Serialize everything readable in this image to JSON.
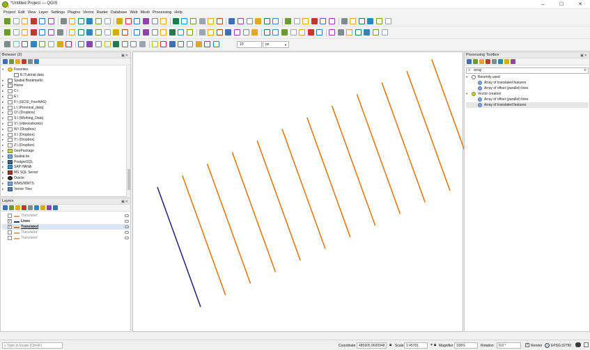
{
  "window": {
    "title": "*Untitled Project — QGIS",
    "minimize": "–",
    "maximize": "☐",
    "close": "✕"
  },
  "menubar": [
    "Project",
    "Edit",
    "View",
    "Layer",
    "Settings",
    "Plugins",
    "Vector",
    "Raster",
    "Database",
    "Web",
    "Mesh",
    "Processing",
    "Help"
  ],
  "digitizing": {
    "distance_value": "10",
    "unit": "px"
  },
  "browser": {
    "title": "Browser (2)",
    "items": [
      {
        "label": "Favorites",
        "type": "star",
        "expanded": true,
        "indent": 0
      },
      {
        "label": "E:\\Tutorial data",
        "type": "folder",
        "indent": 1
      },
      {
        "label": "Spatial Bookmarks",
        "type": "bookmark",
        "indent": 0
      },
      {
        "label": "Home",
        "type": "home",
        "indent": 0
      },
      {
        "label": "C:\\",
        "type": "drive",
        "indent": 0
      },
      {
        "label": "E:\\",
        "type": "drive",
        "indent": 0
      },
      {
        "label": "F:\\ (iSCSI_FreeNAS)",
        "type": "drive",
        "indent": 0
      },
      {
        "label": "L:\\ (Personal_data)",
        "type": "drive",
        "indent": 0
      },
      {
        "label": "O:\\ (Dropbox)",
        "type": "drive",
        "indent": 0
      },
      {
        "label": "S:\\ (Working_Data)",
        "type": "drive",
        "indent": 0
      },
      {
        "label": "V:\\ (videoosbooks)",
        "type": "drive",
        "indent": 0
      },
      {
        "label": "W:\\ (Dropbox)",
        "type": "drive",
        "indent": 0
      },
      {
        "label": "X:\\ (Dropbox)",
        "type": "drive",
        "indent": 0
      },
      {
        "label": "Y:\\ (Dropbox)",
        "type": "drive",
        "indent": 0
      },
      {
        "label": "Z:\\ (Dropbox)",
        "type": "drive",
        "indent": 0
      },
      {
        "label": "GeoPackage",
        "type": "gpkg",
        "indent": 0
      },
      {
        "label": "SpatiaLite",
        "type": "spatialite",
        "indent": 0
      },
      {
        "label": "PostgreSQL",
        "type": "postgres",
        "indent": 0
      },
      {
        "label": "SAP HANA",
        "type": "hana",
        "indent": 0
      },
      {
        "label": "MS SQL Server",
        "type": "mssql",
        "indent": 0
      },
      {
        "label": "Oracle",
        "type": "oracle",
        "indent": 0
      },
      {
        "label": "WMS/WMTS",
        "type": "wms",
        "indent": 0
      },
      {
        "label": "Vector Tiles",
        "type": "vt",
        "indent": 0
      }
    ]
  },
  "layers": {
    "title": "Layers",
    "items": [
      {
        "label": "Translated",
        "checked": false,
        "bold": false,
        "italic": true,
        "color": "#e8a05c"
      },
      {
        "label": "Lines",
        "checked": true,
        "bold": true,
        "italic": false,
        "color": "#2a2a7a"
      },
      {
        "label": "Translated",
        "checked": true,
        "bold": true,
        "italic": false,
        "color": "#e07b16"
      },
      {
        "label": "Translated",
        "checked": false,
        "bold": false,
        "italic": true,
        "color": "#e8a05c"
      },
      {
        "label": "Translated",
        "checked": false,
        "bold": false,
        "italic": true,
        "color": "#e8a05c"
      }
    ]
  },
  "toolbox": {
    "title": "Processing Toolbox",
    "search_value": "array",
    "groups": [
      {
        "label": "Recently used",
        "items": [
          "Array of translated features",
          "Array of offset (parallel) lines"
        ]
      },
      {
        "label": "Vector creation",
        "items": [
          "Array of offset (parallel) lines",
          "Array of translated features"
        ]
      }
    ]
  },
  "status": {
    "locate_placeholder": "Type to locate (Ctrl+K)",
    "coordinate_label": "Coordinate",
    "coordinate_value": "485905,9020948",
    "scale_label": "Scale",
    "scale_value": "1:45701",
    "magnifier_label": "Magnifier",
    "magnifier_value": "100%",
    "rotation_label": "Rotation",
    "rotation_value": "0.0 °",
    "render_label": "Render",
    "crs_label": "EPSG:32750"
  },
  "colors": {
    "accent_orange": "#e07b16",
    "lines_navy": "#2a2a7a",
    "qgis_green": "#93b023"
  },
  "map": {
    "original_line": {
      "layer": "Lines",
      "color": "#2a2a7a"
    },
    "translated_count": 11,
    "translated_color": "#e07b16"
  }
}
